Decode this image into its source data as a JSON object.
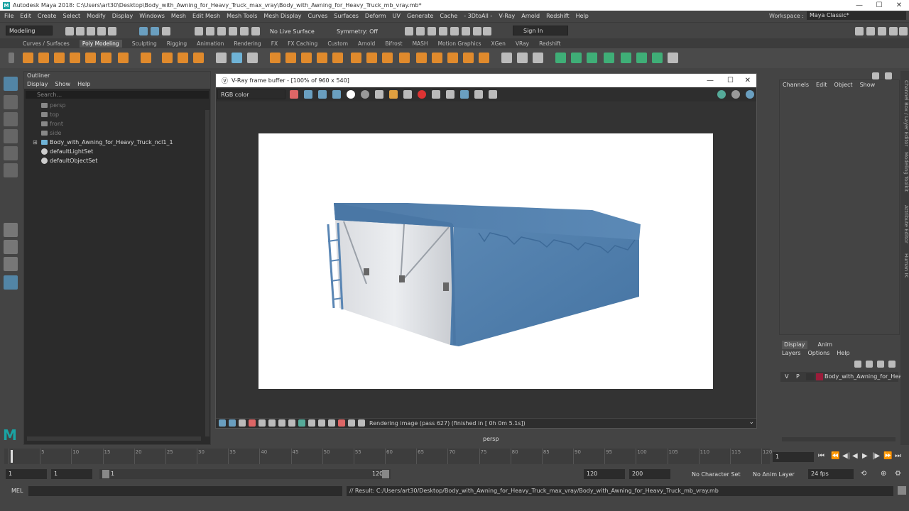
{
  "window": {
    "title": "Autodesk Maya 2018: C:\\Users\\art30\\Desktop\\Body_with_Awning_for_Heavy_Truck_max_vray\\Body_with_Awning_for_Heavy_Truck_mb_vray.mb*",
    "logo": "M",
    "minimize": "—",
    "maximize": "☐",
    "close": "✕"
  },
  "menubar": [
    "File",
    "Edit",
    "Create",
    "Select",
    "Modify",
    "Display",
    "Windows",
    "Mesh",
    "Edit Mesh",
    "Mesh Tools",
    "Mesh Display",
    "Curves",
    "Surfaces",
    "Deform",
    "UV",
    "Generate",
    "Cache",
    "- 3DtoAll -",
    "V-Ray",
    "Arnold",
    "Redshift",
    "Help"
  ],
  "workspace": {
    "label": "Workspace :",
    "value": "Maya Classic*"
  },
  "statusline": {
    "mode": "Modeling",
    "live_surface": "No Live Surface",
    "symmetry": "Symmetry: Off",
    "sign_in": "Sign In"
  },
  "shelf_tabs": [
    "Curves / Surfaces",
    "Poly Modeling",
    "Sculpting",
    "Rigging",
    "Animation",
    "Rendering",
    "FX",
    "FX Caching",
    "Custom",
    "Arnold",
    "Bifrost",
    "MASH",
    "Motion Graphics",
    "XGen",
    "VRay",
    "Redshift"
  ],
  "shelf_active": "Poly Modeling",
  "outliner": {
    "title": "Outliner",
    "menu": [
      "Display",
      "Show",
      "Help"
    ],
    "search_placeholder": "Search...",
    "items": [
      {
        "label": "persp",
        "dim": true
      },
      {
        "label": "top",
        "dim": true
      },
      {
        "label": "front",
        "dim": true
      },
      {
        "label": "side",
        "dim": true
      },
      {
        "label": "Body_with_Awning_for_Heavy_Truck_ncl1_1",
        "dim": false
      },
      {
        "label": "defaultLightSet",
        "dim": false
      },
      {
        "label": "defaultObjectSet",
        "dim": false
      }
    ]
  },
  "vfb": {
    "title": "V-Ray frame buffer - [100% of 960 x 540]",
    "channel": "RGB color",
    "status": "Rendering image (pass 627) (finished in [ 0h  0m  5.1s])"
  },
  "viewport": {
    "camera_label": "persp"
  },
  "channel_box": {
    "menu": [
      "Channels",
      "Edit",
      "Object",
      "Show"
    ]
  },
  "layer_editor": {
    "tabs": [
      "Display",
      "Anim"
    ],
    "menu": [
      "Layers",
      "Options",
      "Help"
    ],
    "layer": {
      "v": "V",
      "p": "P",
      "name": "Body_with_Awning_for_Heavy_",
      "color": "#9b1c3a"
    }
  },
  "side_tabs": [
    "Channel Box / Layer Editor",
    "Modeling Toolkit",
    "Attribute Editor",
    "Human IK"
  ],
  "timeline": {
    "ticks": [
      "1",
      "5",
      "10",
      "15",
      "20",
      "25",
      "30",
      "35",
      "40",
      "45",
      "50",
      "55",
      "60",
      "65",
      "70",
      "75",
      "80",
      "85",
      "90",
      "95",
      "100",
      "105",
      "110",
      "115",
      "120"
    ],
    "current_frame": "1"
  },
  "range": {
    "start": "1",
    "start_inner": "1",
    "slider_start": "1",
    "slider_end": "120",
    "end_inner": "120",
    "end": "200",
    "character_set": "No Character Set",
    "anim_layer": "No Anim Layer",
    "fps": "24 fps"
  },
  "cmdline": {
    "lang": "MEL",
    "result": "// Result: C:/Users/art30/Desktop/Body_with_Awning_for_Heavy_Truck_max_vray/Body_with_Awning_for_Heavy_Truck_mb_vray.mb"
  },
  "colors": {
    "accent": "#5285a6",
    "awning": "#4f7ba8",
    "bg": "#444444"
  }
}
